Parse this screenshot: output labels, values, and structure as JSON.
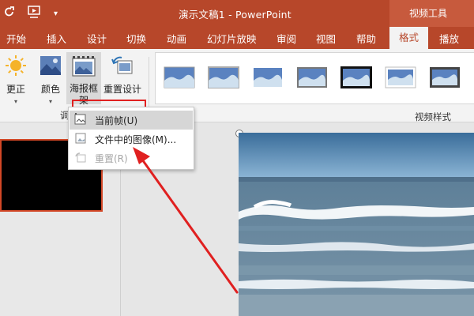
{
  "qat": {
    "autosave_icon": "redo-icon",
    "start_icon": "start-from-beginning-icon",
    "more_icon": "customize-qat-icon",
    "more_glyph": "▾"
  },
  "window": {
    "title": "演示文稿1  -  PowerPoint",
    "context_group": "视频工具"
  },
  "tabs": [
    "开始",
    "插入",
    "设计",
    "切换",
    "动画",
    "幻灯片放映",
    "审阅",
    "视图",
    "帮助",
    "格式",
    "播放"
  ],
  "active_tab": "格式",
  "ribbon": {
    "corrections_label": "更正",
    "color_label": "颜色",
    "poster_label_1": "海报框",
    "poster_label_2": "架",
    "reset_label": "重置设计",
    "group_adjust_label": "调",
    "group_styles_label": "视频样式"
  },
  "poster_menu": {
    "items": [
      {
        "label": "当前帧(U)",
        "state": "highlighted"
      },
      {
        "label": "文件中的图像(M)...",
        "state": "normal"
      },
      {
        "label": "重置(R)",
        "state": "disabled"
      }
    ]
  },
  "annotation": {
    "box_color": "#e02020",
    "arrow_color": "#e02020"
  },
  "colors": {
    "accent": "#b7472a",
    "context_group": "#c75a3d",
    "ribbon_bg": "#f3f3f3"
  }
}
